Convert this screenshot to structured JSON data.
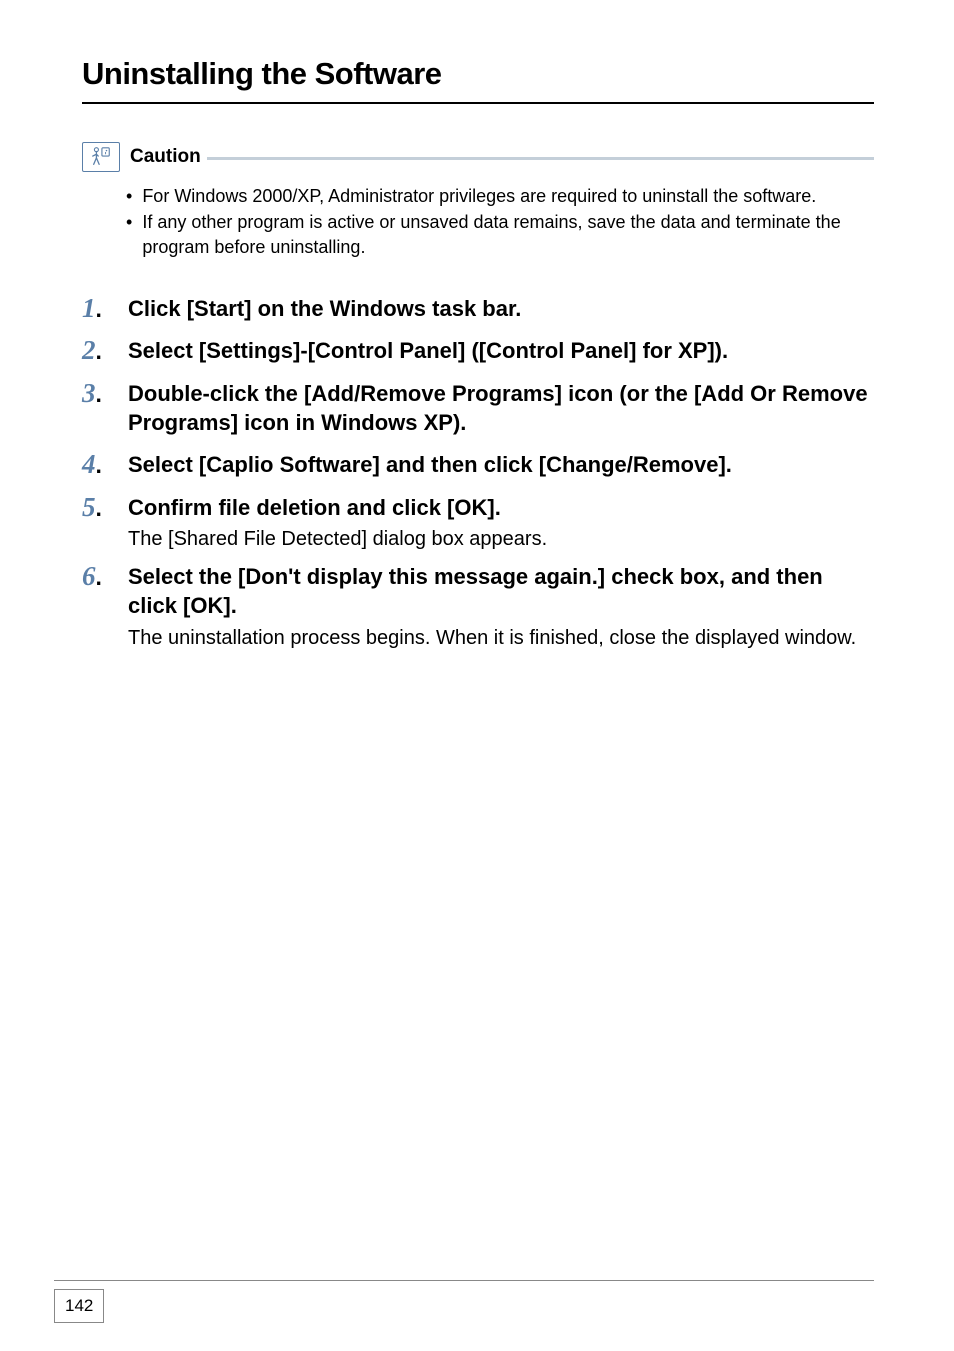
{
  "heading": "Uninstalling the Software",
  "caution": {
    "label": "Caution",
    "items": [
      "For Windows 2000/XP, Administrator privileges are required to uninstall the software.",
      "If any other program is active or unsaved data remains, save the data and terminate the program before uninstalling."
    ]
  },
  "steps": [
    {
      "num": "1",
      "title": "Click [Start] on the Windows task bar."
    },
    {
      "num": "2",
      "title": "Select [Settings]-[Control Panel] ([Control Panel] for XP])."
    },
    {
      "num": "3",
      "title": "Double-click the [Add/Remove Programs] icon (or the [Add Or Remove Programs] icon in Windows XP)."
    },
    {
      "num": "4",
      "title": "Select [Caplio Software] and then click [Change/Remove]."
    },
    {
      "num": "5",
      "title": "Confirm file deletion and click [OK].",
      "desc": "The [Shared File Detected] dialog box appears."
    },
    {
      "num": "6",
      "title": "Select the [Don't display this message again.] check box, and then click [OK].",
      "desc": "The uninstallation process begins. When it is finished, close the displayed window."
    }
  ],
  "page_number": "142"
}
